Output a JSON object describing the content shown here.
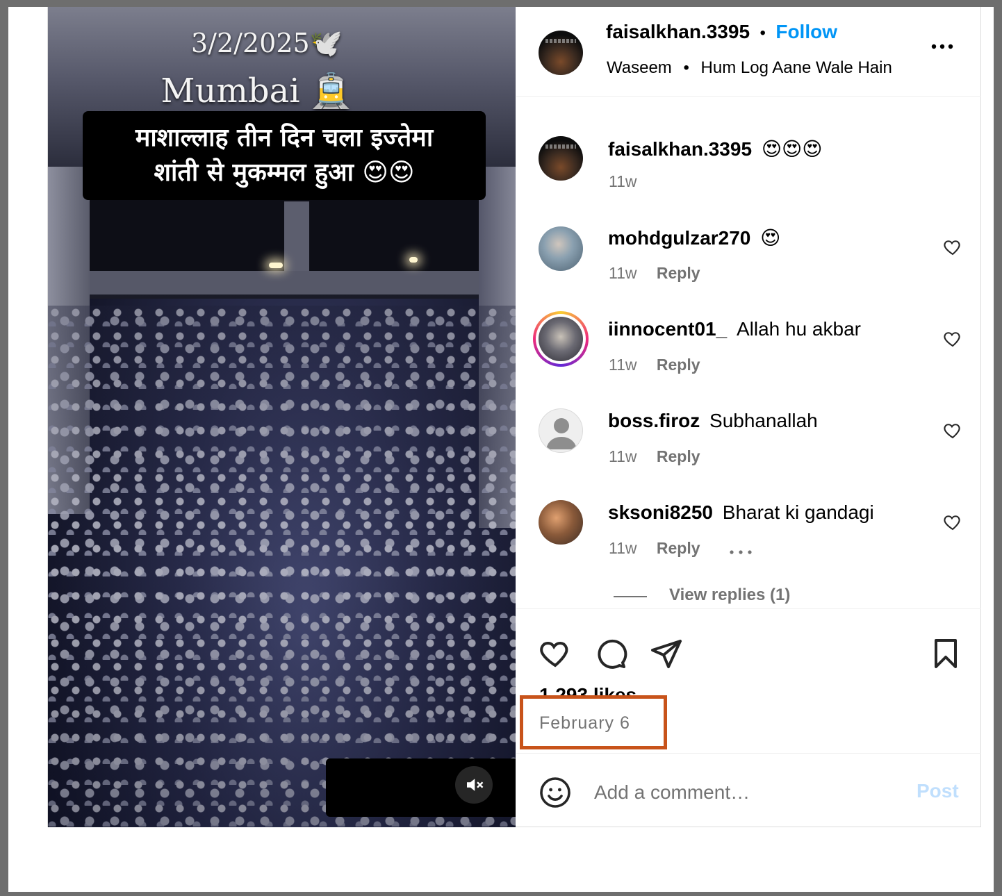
{
  "post": {
    "author": "faisalkhan.3395",
    "follow_label": "Follow",
    "separator": "•",
    "audio_artist": "Waseem",
    "audio_title": "Hum Log Aane Wale Hain",
    "likes": "1,293 likes",
    "date": "February 6",
    "view_replies": "View replies (1)"
  },
  "media": {
    "overlay_date": "3/2/2025🕊️",
    "overlay_city": "Mumbai 🚊",
    "overlay_caption_line1": "माशाल्लाह तीन दिन चला इज्तेमा",
    "overlay_caption_line2": "शांती से मुकम्मल हुआ 😍😍",
    "bottom_emojis": "😍😍😍"
  },
  "comments": [
    {
      "username": "faisalkhan.3395",
      "text": "😍😍😍",
      "age": "11w",
      "reply": ""
    },
    {
      "username": "mohdgulzar270",
      "text": "😍",
      "age": "11w",
      "reply": "Reply"
    },
    {
      "username": "iinnocent01_",
      "text": "Allah hu akbar",
      "age": "11w",
      "reply": "Reply"
    },
    {
      "username": "boss.firoz",
      "text": "Subhanallah",
      "age": "11w",
      "reply": "Reply"
    },
    {
      "username": "sksoni8250",
      "text": "Bharat ki gandagi",
      "age": "11w",
      "reply": "Reply"
    }
  ],
  "composer": {
    "placeholder": "Add a comment…",
    "post_label": "Post"
  },
  "colors": {
    "accent_blue": "#0095f6",
    "highlight_box": "#c8531a",
    "post_disabled": "#c0dffd"
  }
}
